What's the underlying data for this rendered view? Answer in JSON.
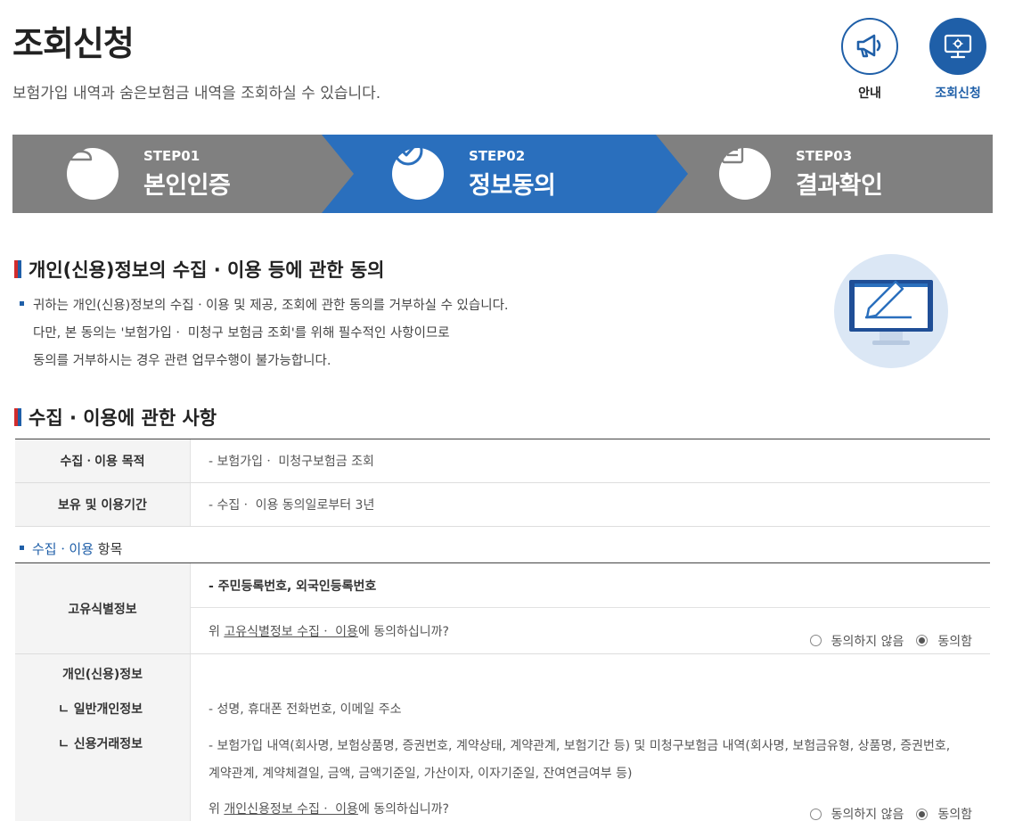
{
  "page": {
    "title": "조회신청",
    "subtitle": "보험가입 내역과 숨은보험금 내역을 조회하실 수 있습니다."
  },
  "top_buttons": [
    {
      "label": "안내",
      "icon": "megaphone-icon"
    },
    {
      "label": "조회신청",
      "icon": "monitor-icon"
    }
  ],
  "steps": [
    {
      "num": "STEP01",
      "name": "본인인증",
      "icon": "person-icon",
      "active": false
    },
    {
      "num": "STEP02",
      "name": "정보동의",
      "icon": "check-circle-icon",
      "active": true
    },
    {
      "num": "STEP03",
      "name": "결과확인",
      "icon": "document-icon",
      "active": false
    }
  ],
  "colors": {
    "active": "#2a6fbd",
    "inactive": "#808080",
    "accent": "#1f5fa8"
  },
  "consent_section": {
    "title": "개인(신용)정보의 수집 · 이용 등에 관한 동의",
    "lines": [
      "귀하는 개인(신용)정보의 수집ㆍ이용 및 제공, 조회에 관한 동의를 거부하실 수 있습니다.",
      "다만, 본 동의는 '보험가입ㆍ 미청구 보험금 조회'를 위해 필수적인 사항이므로",
      "동의를 거부하시는 경우 관련 업무수행이 불가능합니다."
    ]
  },
  "usage_section": {
    "title": "수집 · 이용에 관한 사항",
    "rows": [
      {
        "label": "수집ㆍ이용 목적",
        "value": "- 보험가입ㆍ 미청구보험금 조회"
      },
      {
        "label": "보유 및 이용기간",
        "value": "- 수집ㆍ 이용 동의일로부터 3년"
      }
    ]
  },
  "items_section": {
    "label_blue": "수집ㆍ이용",
    "label_rest": " 항목",
    "unique": {
      "label": "고유식별정보",
      "desc": "- 주민등록번호, 외국인등록번호",
      "q_prefix": "위 ",
      "q_link": "고유식별정보 수집ㆍ 이용",
      "q_suffix": "에 동의하십니까?",
      "opt_disagree": "동의하지 않음",
      "opt_agree": "동의함",
      "selected": "agree"
    },
    "credit": {
      "label_main": "개인(신용)정보",
      "label_sub1": "ㄴ 일반개인정보",
      "label_sub2": "ㄴ 신용거래정보",
      "desc1": "- 성명, 휴대폰 전화번호, 이메일 주소",
      "desc2a": "- 보험가입 내역(회사명, 보험상품명, 증권번호, 계약상태, 계약관계, 보험기간 등) 및 미청구보험금 내역(회사명, 보험금유형, 상품명, 증권번호,",
      "desc2b": "계약관계, 계약체결일, 금액, 금액기준일, 가산이자, 이자기준일, 잔여연금여부 등)",
      "q_prefix": "위 ",
      "q_link": "개인신용정보 수집ㆍ 이용",
      "q_suffix": "에 동의하십니까?",
      "opt_disagree": "동의하지 않음",
      "opt_agree": "동의함",
      "selected": "agree"
    }
  }
}
